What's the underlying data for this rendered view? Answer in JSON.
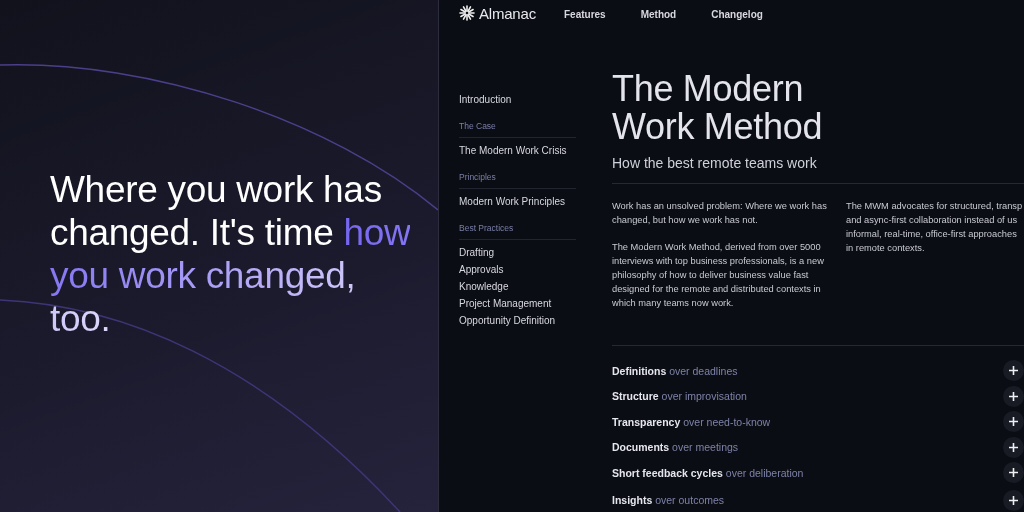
{
  "hero": {
    "text": "Where you work has changed. It's time ",
    "highlight": "how you work changed, too."
  },
  "nav": {
    "brand": "Almanac",
    "links": [
      "Features",
      "Method",
      "Changelog"
    ]
  },
  "sidebar": {
    "groups": [
      {
        "items": [
          "Introduction"
        ]
      },
      {
        "heading": "The Case",
        "items": [
          "The Modern Work Crisis"
        ]
      },
      {
        "heading": "Principles",
        "items": [
          "Modern Work Principles"
        ]
      },
      {
        "heading": "Best Practices",
        "items": [
          "Drafting",
          "Approvals",
          "Knowledge",
          "Project Management",
          "Opportunity Definition"
        ]
      }
    ]
  },
  "article": {
    "title": "The Modern Work Method",
    "subtitle": "How the best remote teams work",
    "column_1": [
      "Work has an unsolved problem: Where we work has changed, but how we work has not.",
      "The Modern Work Method, derived from over 5000 interviews with top business professionals, is a new philosophy of how to deliver business value fast designed for the remote and distributed contexts in which many teams now work."
    ],
    "column_2": [
      [
        "The MWM advocates for structured, transp",
        "and async-first collaboration instead of us",
        "informal, real-time, office-first approaches",
        "in remote contexts."
      ]
    ],
    "principles": [
      {
        "term": "Definitions",
        "contrast": "over deadlines"
      },
      {
        "term": "Structure",
        "contrast": "over improvisation"
      },
      {
        "term": "Transparency",
        "contrast": "over need-to-know"
      },
      {
        "term": "Documents",
        "contrast": "over meetings"
      },
      {
        "term": "Short feedback cycles",
        "contrast": "over deliberation"
      },
      {
        "term": "Insights",
        "contrast": "over outcomes"
      }
    ]
  }
}
